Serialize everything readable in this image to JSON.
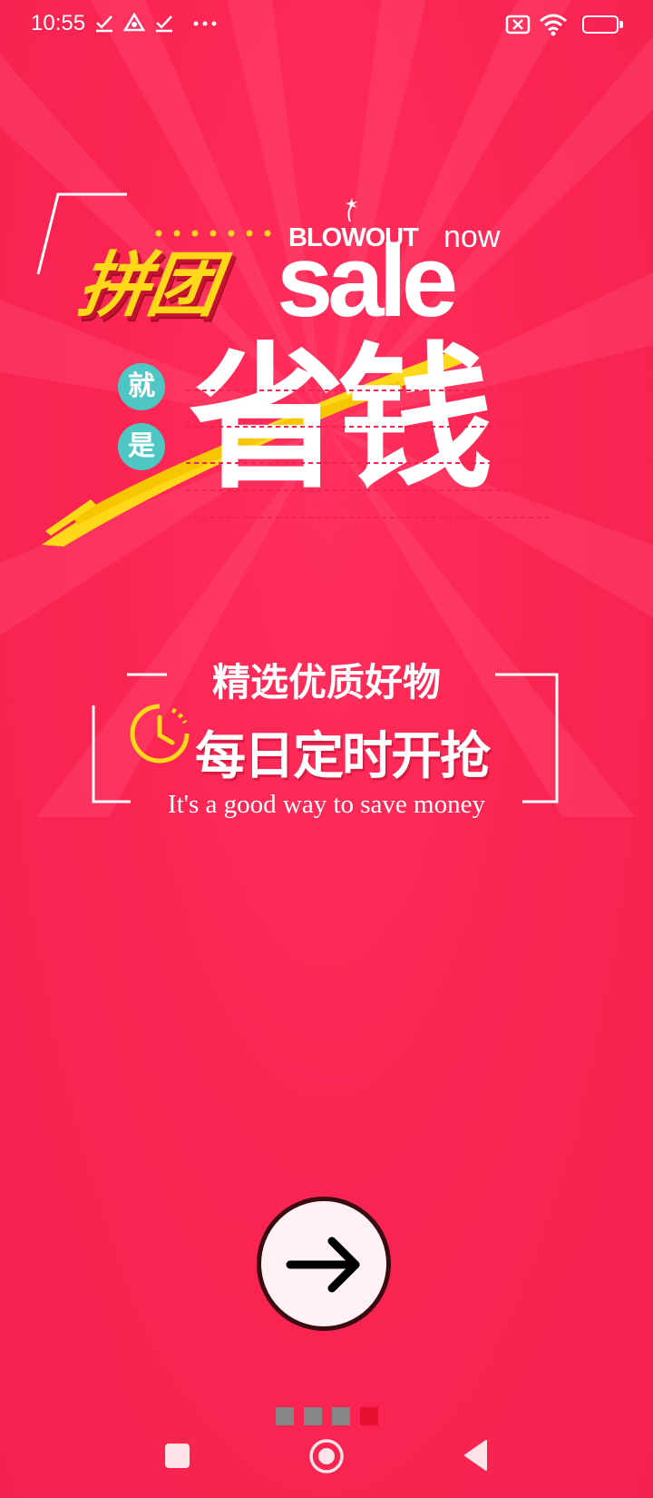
{
  "status_bar": {
    "time": "10:55",
    "battery": "85",
    "battery_level": 0.85,
    "icons": [
      "download-check-icon",
      "drive-icon",
      "download-check-icon",
      "more-dots-icon",
      "sim-x-icon",
      "wifi-icon",
      "battery-icon"
    ]
  },
  "headline": {
    "brand_cn": "拼团",
    "blowout": "BLOWOUT",
    "now": "now",
    "sale": "sale",
    "badge_1": "就",
    "badge_2": "是",
    "main": "省钱"
  },
  "info": {
    "line_1": "精选优质好物",
    "line_2": "每日定时开抢",
    "line_en": "It's a good way to save money"
  },
  "pagination": {
    "total": 4,
    "current": 4
  },
  "colors": {
    "background": "#f5224f",
    "accent_yellow": "#ffd81a",
    "badge_teal": "#4ec7c4",
    "dot_active": "#e8102f",
    "dot_inactive": "#868686"
  },
  "navigation": {
    "icons": [
      "recent-apps-icon",
      "home-icon",
      "back-icon"
    ]
  }
}
